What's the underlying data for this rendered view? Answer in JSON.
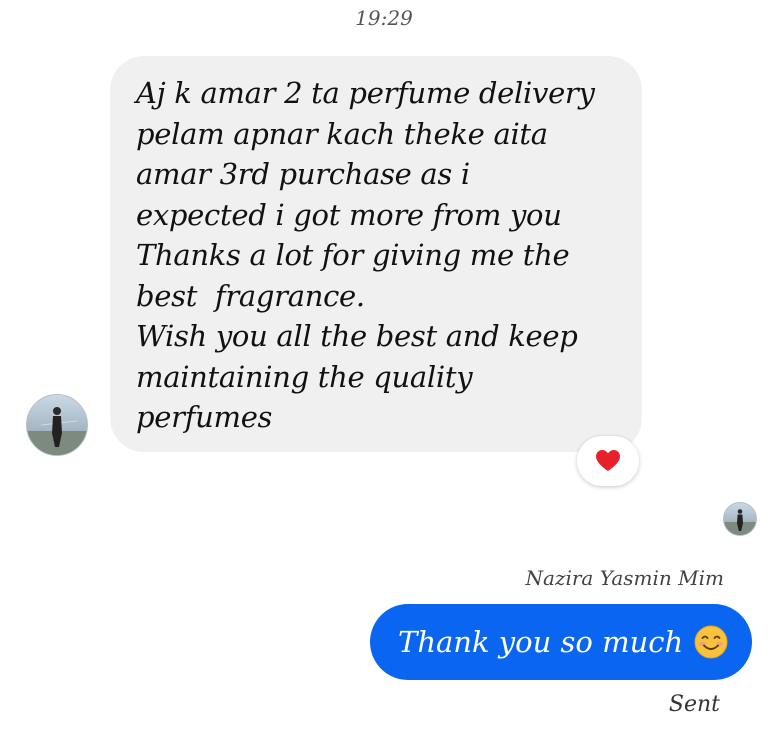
{
  "conversation": {
    "timestamp": "19:29",
    "incoming_message": {
      "lines": [
        "Aj k amar 2 ta perfume delivery",
        "pelam apnar kach theke aita",
        "amar 3rd purchase as i",
        "expected i got more from you",
        "Thanks a lot for giving me the",
        "best  fragrance.",
        "Wish you all the best and keep",
        "maintaining the quality",
        "perfumes"
      ],
      "reaction": "heart-icon",
      "bubble_color": "#f0f0f0"
    },
    "outgoing_message": {
      "sender_name": "Nazira Yasmin Mim",
      "text": "Thank you so much",
      "emoji": "smiling-face-icon",
      "status": "Sent",
      "bubble_color": "#0a66f0"
    }
  }
}
